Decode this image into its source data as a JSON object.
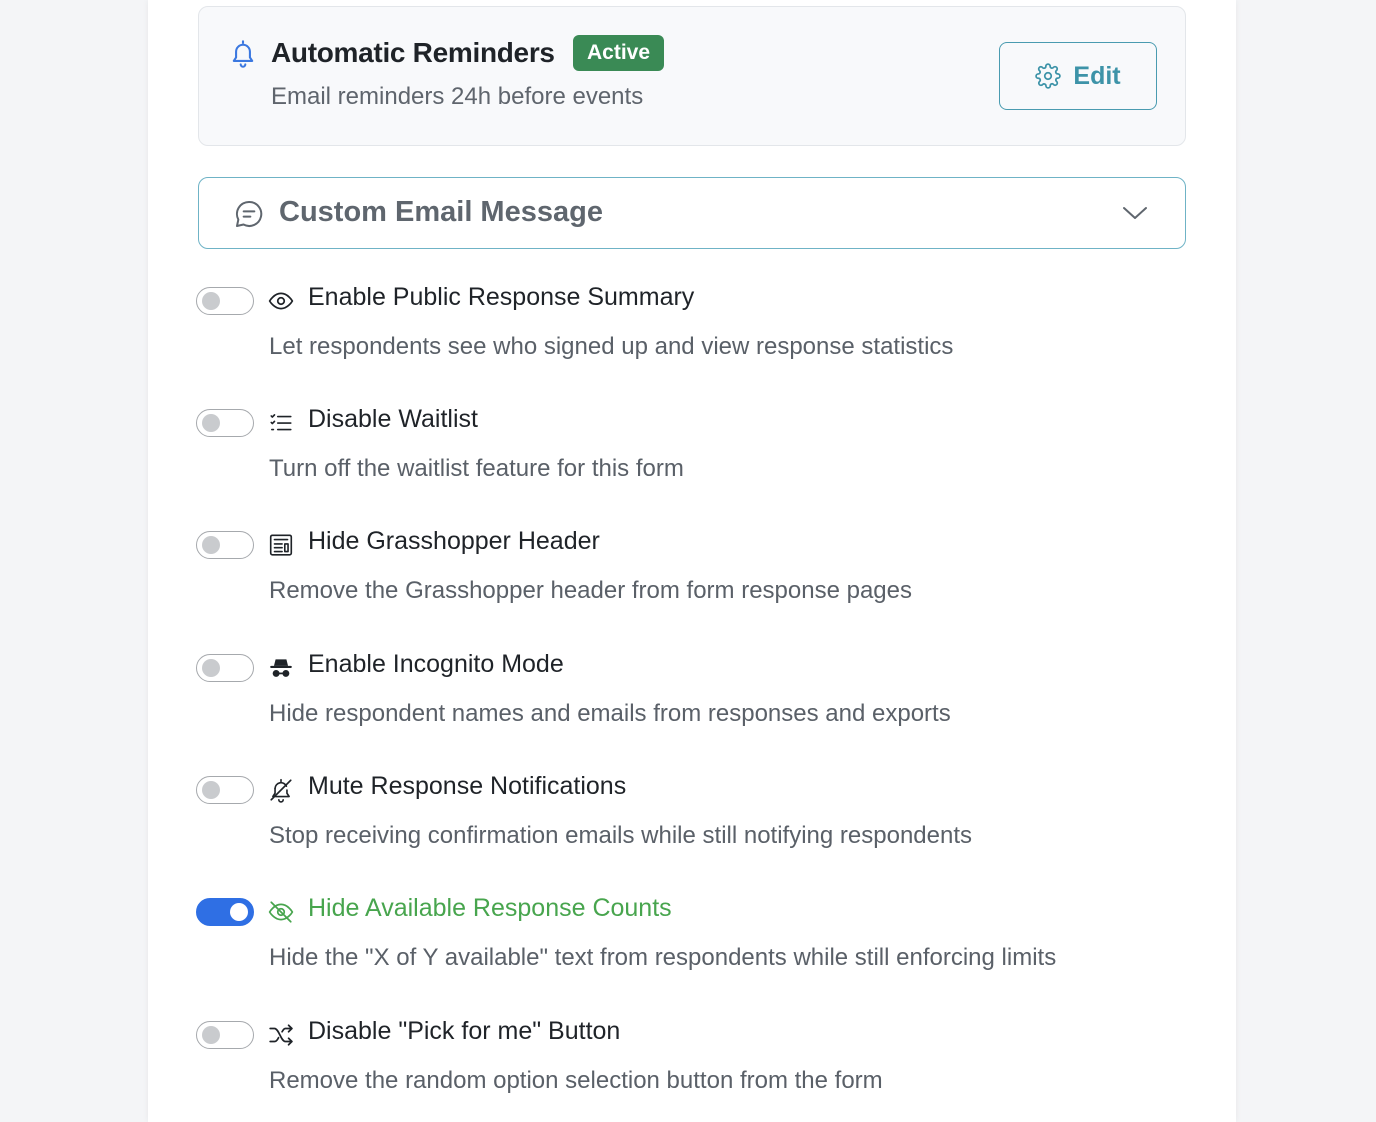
{
  "reminder": {
    "title": "Automatic Reminders",
    "status": "Active",
    "subtitle": "Email reminders 24h before events",
    "edit_label": "Edit",
    "icon": "bell-icon"
  },
  "accordion": {
    "title": "Custom Email Message",
    "icon": "message-icon",
    "expanded": false
  },
  "settings": [
    {
      "title": "Enable Public Response Summary",
      "description": "Let respondents see who signed up and view response statistics",
      "enabled": false,
      "icon": "eye-icon"
    },
    {
      "title": "Disable Waitlist",
      "description": "Turn off the waitlist feature for this form",
      "enabled": false,
      "icon": "list-icon"
    },
    {
      "title": "Hide Grasshopper Header",
      "description": "Remove the Grasshopper header from form response pages",
      "enabled": false,
      "icon": "newspaper-icon"
    },
    {
      "title": "Enable Incognito Mode",
      "description": "Hide respondent names and emails from responses and exports",
      "enabled": false,
      "icon": "incognito-icon"
    },
    {
      "title": "Mute Response Notifications",
      "description": "Stop receiving confirmation emails while still notifying respondents",
      "enabled": false,
      "icon": "bell-off-icon"
    },
    {
      "title": "Hide Available Response Counts",
      "description": "Hide the \"X of Y available\" text from respondents while still enforcing limits",
      "enabled": true,
      "icon": "eye-off-icon"
    },
    {
      "title": "Disable \"Pick for me\" Button",
      "description": "Remove the random option selection button from the form",
      "enabled": false,
      "icon": "shuffle-icon"
    }
  ],
  "colors": {
    "accent_teal": "#3d93a8",
    "badge_green": "#3a8a55",
    "active_green": "#48a54e",
    "toggle_blue": "#2f6fe4"
  }
}
